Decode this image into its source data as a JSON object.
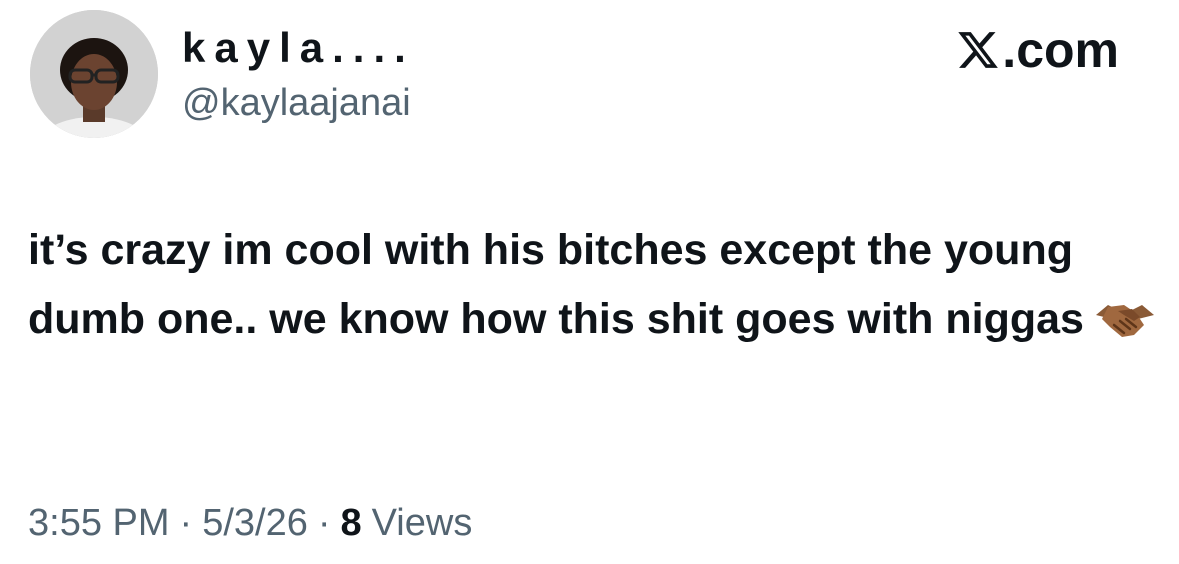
{
  "author": {
    "display_name": "kayla....",
    "handle": "@kaylaajanai"
  },
  "brand": {
    "domain_suffix": ".com",
    "icon": "x-logo-icon"
  },
  "tweet": {
    "text": "it’s crazy im cool with his bitches except the young dumb one.. we know how this shit goes with niggas",
    "emoji_icon": "handshake-icon"
  },
  "meta": {
    "time": "3:55 PM",
    "separator": "·",
    "date": "5/3/26",
    "views_count": "8",
    "views_label": "Views"
  },
  "colors": {
    "text": "#0f1419",
    "secondary": "#536471",
    "background": "#ffffff"
  }
}
